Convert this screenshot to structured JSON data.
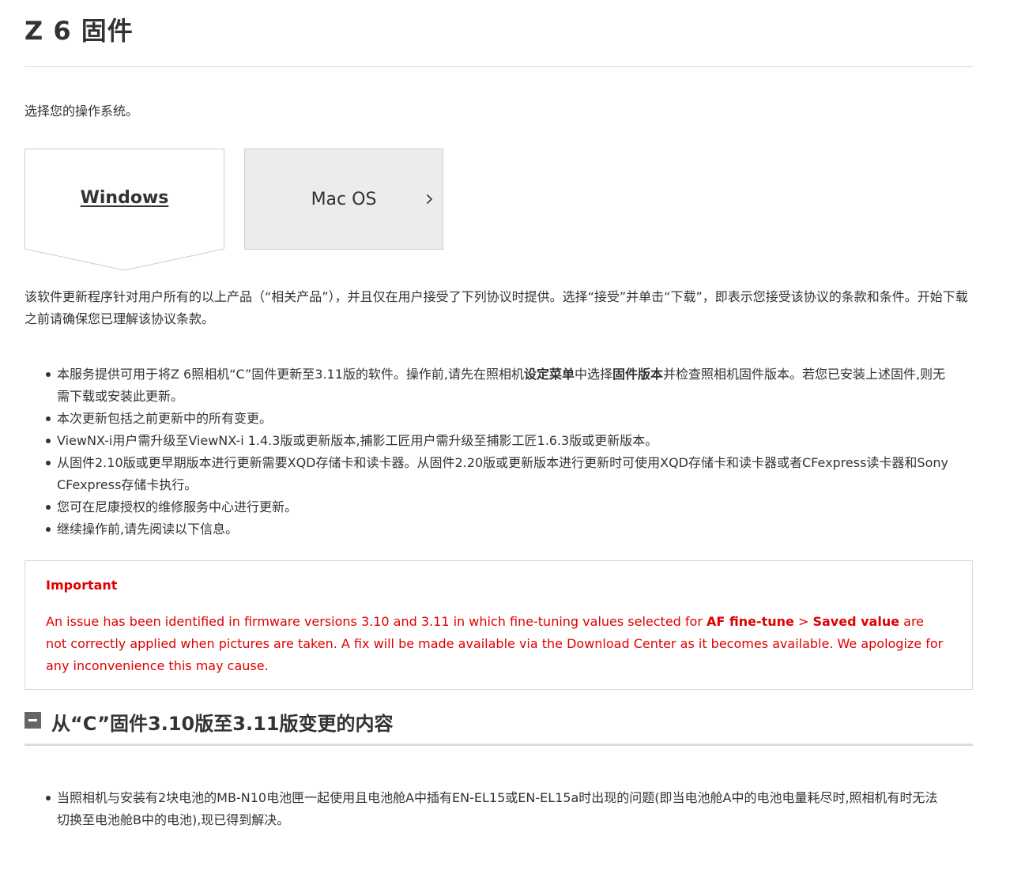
{
  "page": {
    "title": "Z 6 固件",
    "os_prompt": "选择您的操作系统。"
  },
  "os_tabs": [
    {
      "label": "Windows",
      "selected": true
    },
    {
      "label": "Mac OS",
      "selected": false,
      "icon": "chevron-right-icon"
    }
  ],
  "intro": "该软件更新程序针对用户所有的以上产品（“相关产品”），并且仅在用户接受了下列协议时提供。选择“接受”并单击“下载”，即表示您接受该协议的条款和条件。开始下载之前请确保您已理解该协议条款。",
  "notes": [
    {
      "parts": {
        "a": "本服务提供可用于将Z 6照相机“C”固件更新至3.11版的软件。操作前,请先在照相机",
        "b": "设定菜单",
        "c": "中选择",
        "d": "固件版本",
        "e": "并检查照相机固件版本。若您已安装上述固件,则无需下载或安装此更新。"
      }
    },
    {
      "text": "本次更新包括之前更新中的所有变更。"
    },
    {
      "text": "ViewNX-i用户需升级至ViewNX-i 1.4.3版或更新版本,捕影工匠用户需升级至捕影工匠1.6.3版或更新版本。"
    },
    {
      "text": "从固件2.10版或更早期版本进行更新需要XQD存储卡和读卡器。从固件2.20版或更新版本进行更新时可使用XQD存储卡和读卡器或者CFexpress读卡器和Sony CFexpress存储卡执行。"
    },
    {
      "text": "您可在尼康授权的维修服务中心进行更新。"
    },
    {
      "text": "继续操作前,请先阅读以下信息。"
    }
  ],
  "important": {
    "heading": "Important",
    "text_before": "An issue has been identified in firmware versions 3.10 and 3.11 in which fine-tuning values selected for ",
    "bold_1": "AF fine-tune",
    "separator": " > ",
    "bold_2": "Saved value",
    "text_after": " are not correctly applied when pictures are taken. A fix will be made available via the Download Center as it becomes available. We apologize for any inconvenience this may cause.",
    "color": "#e00000"
  },
  "section": {
    "title": "从“C”固件3.10版至3.11版变更的内容",
    "toggle_icon": "collapse-minus-icon"
  },
  "changes": [
    {
      "text": "当照相机与安装有2块电池的MB-N10电池匣一起使用且电池舱A中插有EN-EL15或EN-EL15a时出现的问题(即当电池舱A中的电池电量耗尽时,照相机有时无法切换至电池舱B中的电池),现已得到解决。"
    }
  ]
}
